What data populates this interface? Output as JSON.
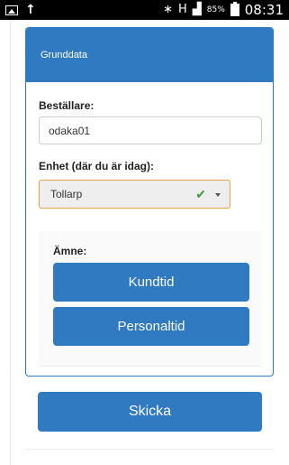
{
  "status_bar": {
    "battery_text": "85%",
    "time": "08:31",
    "network_label": "H"
  },
  "panel": {
    "header_title": "Grunddata",
    "orderer_label": "Beställare:",
    "orderer_value": "odaka01",
    "unit_label": "Enhet (där du är idag):",
    "unit_value": "Tollarp",
    "subject_label": "Ämne:",
    "buttons": [
      "Kundtid",
      "Personaltid"
    ]
  },
  "submit_label": "Skicka",
  "colors": {
    "primary": "#2f7ac0",
    "select_border": "#e8a34a",
    "check": "#3c9b3c"
  }
}
